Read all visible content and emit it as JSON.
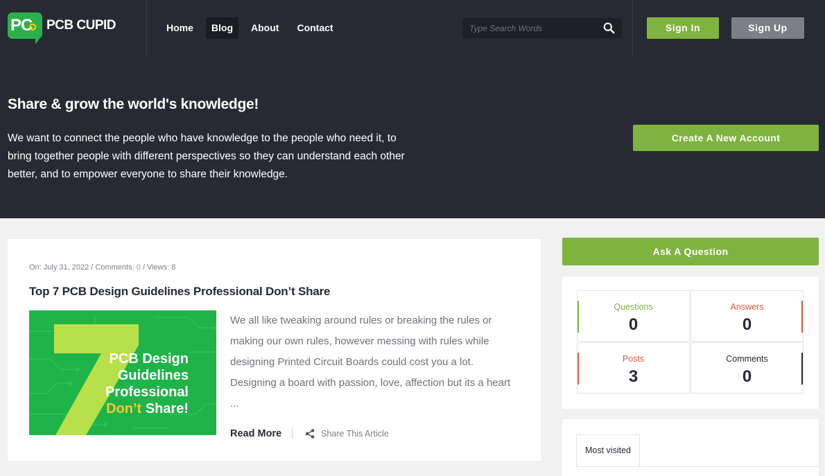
{
  "brand": {
    "badge": "PC",
    "name": "PCB CUPID"
  },
  "nav": {
    "items": [
      {
        "label": "Home",
        "active": false
      },
      {
        "label": "Blog",
        "active": true
      },
      {
        "label": "About",
        "active": false
      },
      {
        "label": "Contact",
        "active": false
      }
    ]
  },
  "search": {
    "placeholder": "Type Search Words"
  },
  "auth": {
    "signin_label": "Sign In",
    "signup_label": "Sign Up"
  },
  "hero": {
    "title": "Share & grow the world's knowledge!",
    "text": "We want to connect the people who have knowledge to the people who need it, to bring together people with different perspectives so they can understand each other better, and to empower everyone to share their knowledge.",
    "create_account_label": "Create A New Account"
  },
  "article": {
    "meta_prefix": "On: July 31, 2022 / Comments: ",
    "comments_count": "0",
    "meta_suffix": " / Views: 8",
    "title": "Top 7 PCB Design Guidelines Professional Don’t Share",
    "image": {
      "number": "7",
      "line1": "PCB Design",
      "line2": "Guidelines",
      "line3": "Professional",
      "highlight": "Don’t",
      "line4_rest": "Share!"
    },
    "excerpt": "We all like tweaking around rules or breaking the rules or making our own rules, however messing with rules while designing Printed Circuit Boards could cost you a lot. Designing a board with passion, love, affection but its a heart ...",
    "read_more_label": "Read More",
    "share_label": "Share This Article"
  },
  "sidebar": {
    "ask_label": "Ask A Question",
    "stats": [
      {
        "label": "Questions",
        "value": "0",
        "color": "#7fb33f"
      },
      {
        "label": "Answers",
        "value": "0",
        "color": "#e9573f"
      },
      {
        "label": "Posts",
        "value": "3",
        "color": "#e9573f"
      },
      {
        "label": "Comments",
        "value": "0",
        "color": "#272a33"
      }
    ],
    "tab_label": "Most visited"
  },
  "colors": {
    "header_bg": "#272a33",
    "accent_green": "#7fb33f",
    "secondary_gray": "#7c7f86",
    "brand_green": "#2db04b"
  }
}
